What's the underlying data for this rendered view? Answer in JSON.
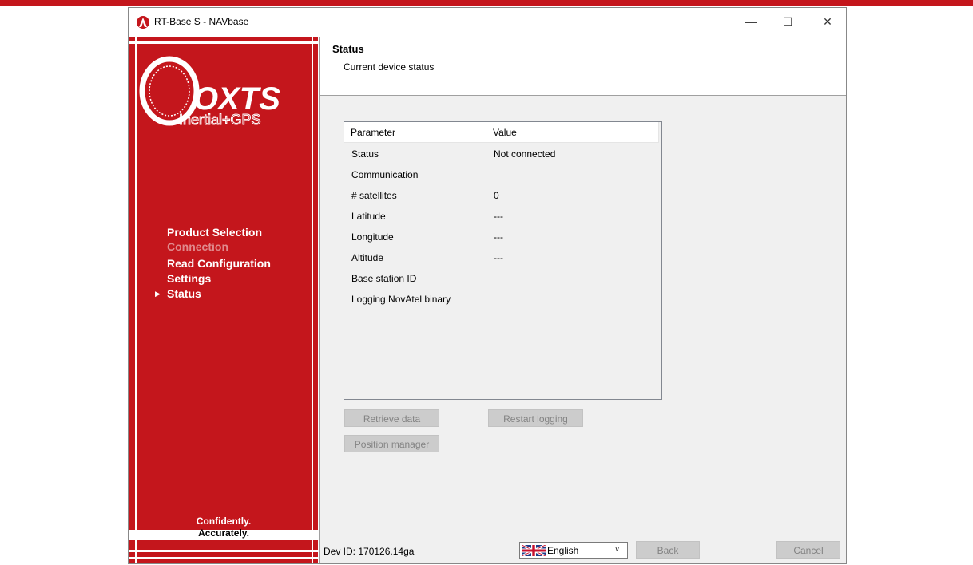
{
  "window": {
    "title": "RT-Base S - NAVbase",
    "controls": {
      "minimize": "—",
      "maximize": "☐",
      "close": "✕"
    }
  },
  "sidebar": {
    "logo_brand": "OXTS",
    "logo_tagline": "Inertial+GPS",
    "nav_items": [
      {
        "label": "Product Selection",
        "state": "done"
      },
      {
        "label": "Connection",
        "state": "disabled"
      },
      {
        "label": "Read Configuration",
        "state": "done"
      },
      {
        "label": "Settings",
        "state": "done"
      },
      {
        "label": "Status",
        "state": "current"
      }
    ],
    "current_marker": "▶",
    "slogan_1": "Confidently.",
    "slogan_2": "Accurately."
  },
  "header": {
    "title": "Status",
    "subtitle": "Current device status"
  },
  "table": {
    "columns": [
      "Parameter",
      "Value"
    ],
    "rows": [
      {
        "parameter": "Status",
        "value": "Not connected"
      },
      {
        "parameter": "Communication",
        "value": ""
      },
      {
        "parameter": "# satellites",
        "value": "0"
      },
      {
        "parameter": "Latitude",
        "value": "---"
      },
      {
        "parameter": "Longitude",
        "value": "---"
      },
      {
        "parameter": "Altitude",
        "value": "---"
      },
      {
        "parameter": "Base station ID",
        "value": ""
      },
      {
        "parameter": "Logging NovAtel binary",
        "value": ""
      }
    ]
  },
  "buttons": {
    "retrieve_data": "Retrieve data",
    "restart_logging": "Restart logging",
    "position_manager": "Position manager",
    "back": "Back",
    "cancel": "Cancel"
  },
  "footer": {
    "dev_id": "Dev ID: 170126.14ga",
    "language": "English"
  },
  "colors": {
    "brand_red": "#c4161c",
    "disabled_nav": "#e08a8d",
    "disabled_button_bg": "#cccccc",
    "disabled_button_text": "#838383"
  },
  "icons": {
    "app_icon": "oxts-app-icon",
    "flag": "uk-flag-icon",
    "dropdown": "chevron-down-icon",
    "nav_marker": "current-step-arrow-icon"
  }
}
